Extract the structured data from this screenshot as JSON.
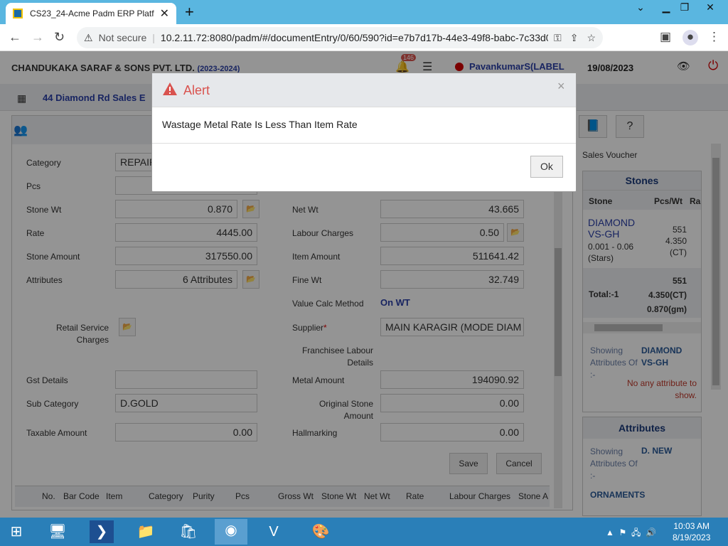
{
  "browser": {
    "tab_title": "CS23_24-Acme Padm ERP Platfor",
    "not_secure": "Not secure",
    "url": "10.2.11.72:8080/padm/#/documentEntry/0/60/590?id=e7b7d17b-44e3-49f8-babc-7c33d078..."
  },
  "header": {
    "company": "CHANDUKAKA SARAF & SONS PVT. LTD.",
    "year": "(2023-2024)",
    "notif_count": "146",
    "user": "PavankumarS(LABEL",
    "date": "19/08/2023"
  },
  "subbar": {
    "breadcrumb": "44 Diamond Rd Sales E"
  },
  "form": {
    "category_label": "Category",
    "category_value": "REPAIR",
    "pcs_label": "Pcs",
    "stone_wt_label": "Stone Wt",
    "stone_wt_value": "0.870",
    "rate_label": "Rate",
    "rate_value": "4445.00",
    "stone_amount_label": "Stone Amount",
    "stone_amount_value": "317550.00",
    "attributes_label": "Attributes",
    "attributes_value": "6 Attributes",
    "retail_service_label": "Retail Service Charges",
    "gst_label": "Gst Details",
    "sub_category_label": "Sub Category",
    "sub_category_value": "D.GOLD",
    "taxable_label": "Taxable Amount",
    "taxable_value": "0.00",
    "net_wt_label": "Net Wt",
    "net_wt_value": "43.665",
    "labour_label": "Labour Charges",
    "labour_value": "0.50",
    "item_amount_label": "Item Amount",
    "item_amount_value": "511641.42",
    "fine_wt_label": "Fine Wt",
    "fine_wt_value": "32.749",
    "value_calc_label": "Value Calc Method",
    "value_calc_value": "On WT",
    "supplier_label": "Supplier",
    "supplier_value": "MAIN KARAGIR (MODE DIAM",
    "franchisee_label": "Franchisee Labour Details",
    "metal_amount_label": "Metal Amount",
    "metal_amount_value": "194090.92",
    "orig_stone_label": "Original Stone Amount",
    "orig_stone_value": "0.00",
    "hallmarking_label": "Hallmarking",
    "hallmarking_value": "0.00",
    "save": "Save",
    "cancel": "Cancel"
  },
  "grid": {
    "columns": [
      "No.",
      "Bar Code",
      "Item",
      "Category",
      "Purity",
      "Pcs",
      "Gross Wt",
      "Stone Wt",
      "Net Wt",
      "Rate",
      "Labour Charges",
      "Stone A"
    ]
  },
  "right": {
    "sales_voucher": "Sales Voucher",
    "stones_title": "Stones",
    "col_stone": "Stone",
    "col_pcswt": "Pcs/Wt",
    "col_rate": "Ra",
    "stone_name": "DIAMOND VS-GH",
    "stone_size": "0.001 - 0.06 (Stars)",
    "stone_pcs": "551",
    "stone_wt": "4.350 (CT)",
    "total_label": "Total:-1",
    "total_pcs": "551",
    "total_ct": "4.350(CT)",
    "total_gm": "0.870(gm)",
    "showing1": "Showing Attributes Of :-",
    "showing1_val": "DIAMOND VS-GH",
    "no_attr": "No any attribute to show.",
    "attributes_title": "Attributes",
    "showing2": "Showing Attributes Of :-",
    "showing2_val": "D. NEW",
    "ornaments": "ORNAMENTS"
  },
  "modal": {
    "title": "Alert",
    "message": "Wastage Metal Rate Is Less Than Item Rate",
    "ok": "Ok"
  },
  "taskbar": {
    "time": "10:03 AM",
    "date": "8/19/2023"
  }
}
